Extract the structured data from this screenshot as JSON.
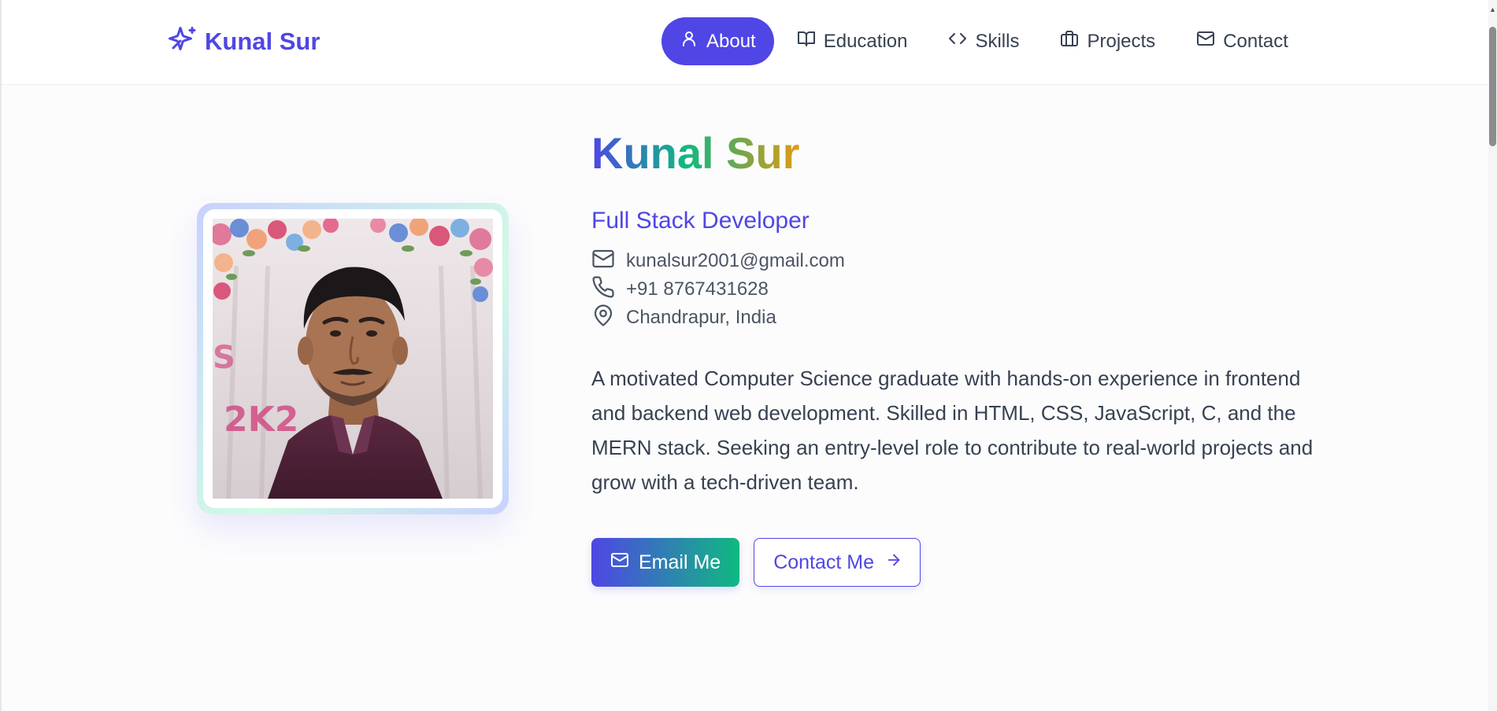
{
  "brand": {
    "name": "Kunal Sur",
    "icon": "sparkles-icon"
  },
  "nav": {
    "items": [
      {
        "label": "About",
        "icon": "user-icon",
        "active": true
      },
      {
        "label": "Education",
        "icon": "book-icon",
        "active": false
      },
      {
        "label": "Skills",
        "icon": "code-icon",
        "active": false
      },
      {
        "label": "Projects",
        "icon": "briefcase-icon",
        "active": false
      },
      {
        "label": "Contact",
        "icon": "mail-icon",
        "active": false
      }
    ]
  },
  "hero": {
    "name": "Kunal Sur",
    "role": "Full Stack Developer",
    "contacts": {
      "email": "kunalsur2001@gmail.com",
      "phone": "+91 8767431628",
      "location": "Chandrapur, India"
    },
    "bio": "A motivated Computer Science graduate with hands-on experience in frontend and backend web development. Skilled in HTML, CSS, JavaScript, C, and the MERN stack. Seeking an entry-level role to contribute to real-world projects and grow with a tech-driven team.",
    "buttons": {
      "email_label": "Email Me",
      "contact_label": "Contact Me"
    },
    "photo_caption": "2K23"
  },
  "colors": {
    "accent": "#4f46e5",
    "accent_secondary": "#10b981",
    "gradient_end": "#e09b14"
  }
}
